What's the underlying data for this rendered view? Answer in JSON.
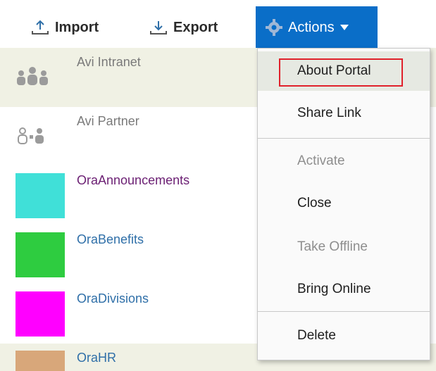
{
  "toolbar": {
    "import_label": "Import",
    "export_label": "Export",
    "actions_label": "Actions"
  },
  "list": [
    {
      "label": "Avi Intranet",
      "icon": "group-people-icon",
      "style": "dim",
      "highlighted": true
    },
    {
      "label": "Avi Partner",
      "icon": "partner-people-icon",
      "style": "dim",
      "highlighted": false
    },
    {
      "label": "OraAnnouncements",
      "color": "#40e0d8",
      "style": "visited"
    },
    {
      "label": "OraBenefits",
      "color": "#2ecc40",
      "style": "link"
    },
    {
      "label": "OraDivisions",
      "color": "#ff00ff",
      "style": "link"
    },
    {
      "label": "OraHR",
      "color": "#d8a77a",
      "style": "link",
      "highlighted": true
    }
  ],
  "menu": {
    "items": [
      {
        "label": "About Portal",
        "enabled": true
      },
      {
        "label": "Share Link",
        "enabled": true
      },
      {
        "label": "Activate",
        "enabled": false
      },
      {
        "label": "Close",
        "enabled": true
      },
      {
        "label": "Take Offline",
        "enabled": false
      },
      {
        "label": "Bring Online",
        "enabled": true
      },
      {
        "label": "Delete",
        "enabled": true
      }
    ]
  },
  "colors": {
    "accent": "#0a6ec8",
    "focus_outline": "#e0212b"
  }
}
